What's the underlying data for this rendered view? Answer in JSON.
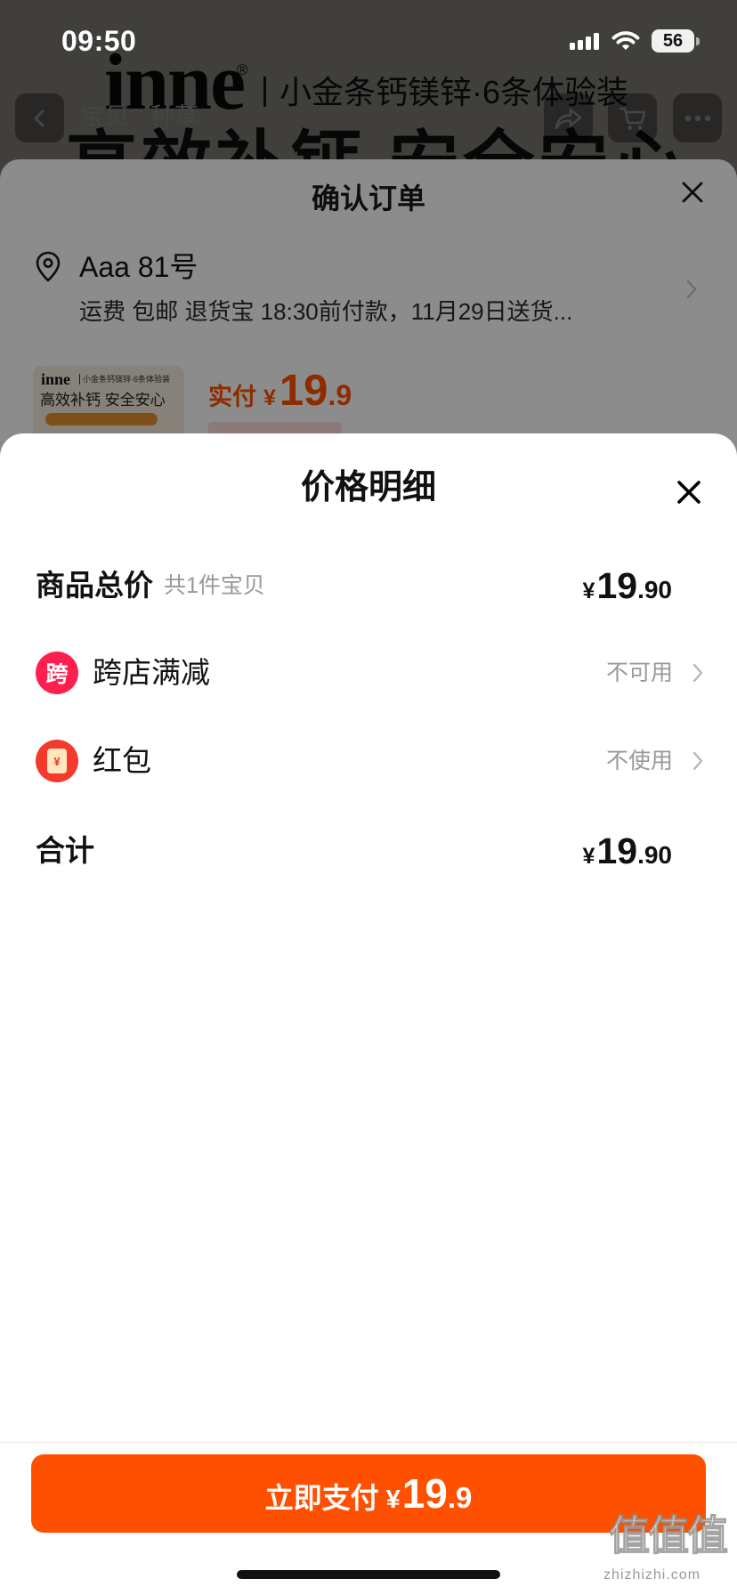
{
  "status_bar": {
    "time": "09:50",
    "battery_level": "56",
    "icons": [
      "cellular-signal-icon",
      "wifi-icon",
      "battery-icon"
    ]
  },
  "product_page": {
    "brand_logo": "inne",
    "brand_registered_mark": "®",
    "product_title": "小金条钙镁锌·6条体验装",
    "nav_tabs": [
      "宝贝",
      "种草"
    ],
    "banner_headline": "高效补钙 安全安心",
    "nav_icons": [
      "back-icon",
      "share-icon",
      "cart-icon",
      "more-icon"
    ]
  },
  "confirm_order": {
    "title": "确认订单",
    "close_icon": "close-icon",
    "address": {
      "icon": "location-pin-icon",
      "recipient": "Aaa 81号",
      "delivery_info": "运费 包邮 退货宝 18:30前付款，11月29日送货..."
    },
    "item": {
      "thumbnail": {
        "brand": "inne",
        "subtitle": "小金条钙镁锌·6条体验装",
        "slogan": "高效补钙 安全安心"
      },
      "paid_label": "实付",
      "currency": "¥",
      "price_integer": "19",
      "price_decimal": ".9"
    }
  },
  "price_detail": {
    "title": "价格明细",
    "close_icon": "close-icon",
    "goods_total": {
      "label": "商品总价",
      "note": "共1件宝贝",
      "currency": "¥",
      "amount_integer": "19",
      "amount_decimal": ".90"
    },
    "cross_store_discount": {
      "badge": "跨",
      "label": "跨店满减",
      "status": "不可用"
    },
    "red_packet": {
      "badge": "¥",
      "label": "红包",
      "status": "不使用"
    },
    "total": {
      "label": "合计",
      "currency": "¥",
      "amount_integer": "19",
      "amount_decimal": ".90"
    }
  },
  "pay_button": {
    "label": "立即支付",
    "currency": "¥",
    "amount_integer": "19",
    "amount_decimal": ".9"
  },
  "watermark": {
    "logo": "值值值",
    "site": "zhizhizhi.com"
  },
  "colors": {
    "accent": "#FF5000",
    "cross_store_badge": "#FF1F4E",
    "red_packet_badge": "#F33A2C",
    "muted_text": "#999999"
  }
}
